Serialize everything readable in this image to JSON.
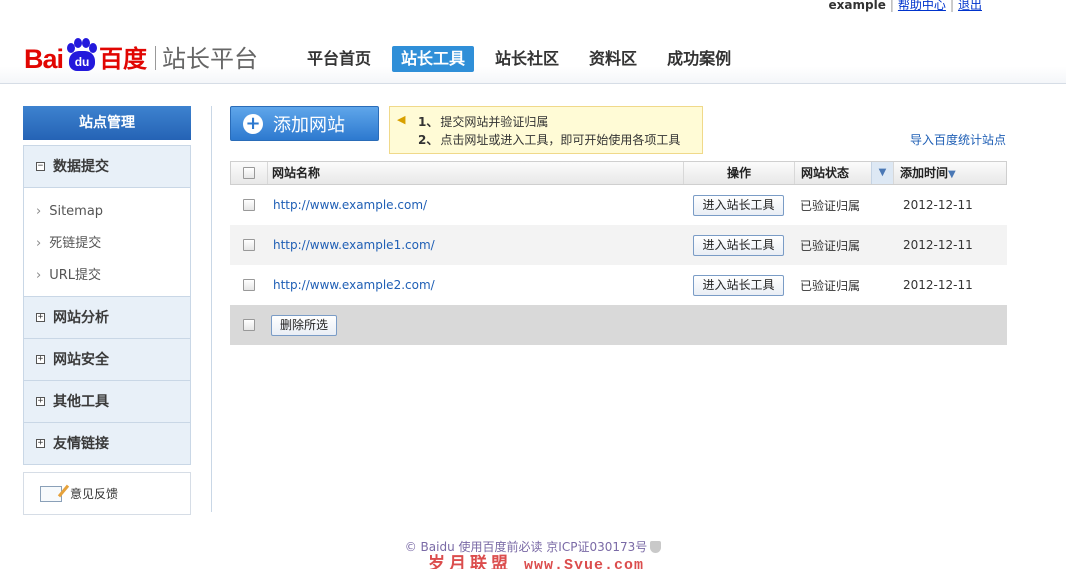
{
  "toplinks": {
    "user": "example",
    "help": "帮助中心",
    "logout": "退出"
  },
  "logo": {
    "latin": "Bai",
    "paw": "du",
    "cn": "百度",
    "platform": "站长平台"
  },
  "nav": [
    {
      "label": "平台首页",
      "active": false
    },
    {
      "label": "站长工具",
      "active": true
    },
    {
      "label": "站长社区",
      "active": false
    },
    {
      "label": "资料区",
      "active": false
    },
    {
      "label": "成功案例",
      "active": false
    }
  ],
  "sidebar": {
    "title": "站点管理",
    "sections": [
      {
        "label": "数据提交",
        "expanded": true,
        "icon": "⊟"
      },
      {
        "label": "网站分析",
        "expanded": false,
        "icon": "⊞"
      },
      {
        "label": "网站安全",
        "expanded": false,
        "icon": "⊞"
      },
      {
        "label": "其他工具",
        "expanded": false,
        "icon": "⊞"
      },
      {
        "label": "友情链接",
        "expanded": false,
        "icon": "⊞"
      }
    ],
    "subitems": [
      "Sitemap",
      "死链提交",
      "URL提交"
    ],
    "feedback": "意见反馈"
  },
  "main": {
    "add_site": "添加网站",
    "tips": [
      {
        "num": "1、",
        "text": "提交网站并验证归属"
      },
      {
        "num": "2、",
        "text": "点击网址或进入工具，即可开始使用各项工具"
      }
    ],
    "import_link": "导入百度统计站点"
  },
  "table": {
    "headers": {
      "name": "网站名称",
      "op": "操作",
      "status": "网站状态",
      "time": "添加时间"
    },
    "rows": [
      {
        "url": "http://www.example.com/",
        "action": "进入站长工具",
        "status": "已验证归属",
        "date": "2012-12-11"
      },
      {
        "url": "http://www.example1.com/",
        "action": "进入站长工具",
        "status": "已验证归属",
        "date": "2012-12-11"
      },
      {
        "url": "http://www.example2.com/",
        "action": "进入站长工具",
        "status": "已验证归属",
        "date": "2012-12-11"
      }
    ],
    "delete_selected": "删除所选"
  },
  "footer": {
    "text": "© Baidu 使用百度前必读 京ICP证030173号"
  },
  "watermark": {
    "cn": "岁月联盟",
    "url": "www.Syue.com"
  },
  "colors": {
    "brand_red": "#e10602",
    "nav_active": "#2f8fd8",
    "link": "#1f5fb5"
  }
}
